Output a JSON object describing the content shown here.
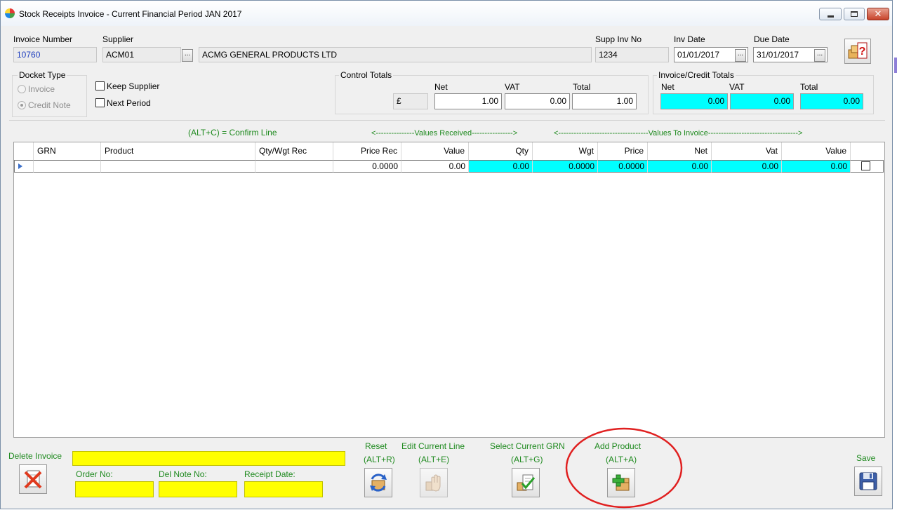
{
  "window": {
    "title": "Stock Receipts Invoice - Current Financial Period JAN 2017",
    "min_glyph": "",
    "close_glyph": "✕"
  },
  "header": {
    "invoice_number_label": "Invoice Number",
    "invoice_number": "10760",
    "supplier_label": "Supplier",
    "supplier_code": "ACM01",
    "supplier_name": "ACMG GENERAL PRODUCTS LTD",
    "supp_inv_no_label": "Supp Inv No",
    "supp_inv_no": "1234",
    "inv_date_label": "Inv Date",
    "inv_date": "01/01/2017",
    "due_date_label": "Due Date",
    "due_date": "31/01/2017",
    "lookup_glyph": "..."
  },
  "docket_type": {
    "title": "Docket Type",
    "options": [
      {
        "label": "Invoice",
        "selected": false
      },
      {
        "label": "Credit Note",
        "selected": true
      }
    ]
  },
  "options": {
    "keep_supplier": "Keep Supplier",
    "next_period": "Next Period"
  },
  "control_totals": {
    "title": "Control Totals",
    "currency": "£",
    "net_label": "Net",
    "vat_label": "VAT",
    "total_label": "Total",
    "net": "1.00",
    "vat": "0.00",
    "total": "1.00"
  },
  "invoice_totals": {
    "title": "Invoice/Credit Totals",
    "net_label": "Net",
    "vat_label": "VAT",
    "total_label": "Total",
    "net": "0.00",
    "vat": "0.00",
    "total": "0.00"
  },
  "grid_captions": {
    "confirm_line": "(ALT+C) = Confirm Line",
    "values_received": "<---------------Values Received---------------->",
    "values_to_invoice": "<-----------------------------------Values To Invoice----------------------------------->"
  },
  "grid": {
    "columns": [
      "GRN",
      "Product",
      "Qty/Wgt Rec",
      "Price Rec",
      "Value",
      "Qty",
      "Wgt",
      "Price",
      "Net",
      "Vat",
      "Value"
    ],
    "row": [
      "",
      "",
      "",
      "0.0000",
      "0.00",
      "0.00",
      "0.0000",
      "0.0000",
      "0.00",
      "0.00",
      "0.00"
    ]
  },
  "footer": {
    "delete_invoice": "Delete Invoice",
    "order_no": "Order No:",
    "del_note_no": "Del Note No:",
    "receipt_date": "Receipt Date:",
    "reset": "Reset",
    "reset_key": "(ALT+R)",
    "edit_line": "Edit Current Line",
    "edit_key": "(ALT+E)",
    "select_grn": "Select Current GRN",
    "select_key": "(ALT+G)",
    "add_product": "Add Product",
    "add_key": "(ALT+A)",
    "save": "Save"
  },
  "colors": {
    "accent_green": "#1f8a1f",
    "cyan": "#00ffff",
    "yellow": "#ffff00",
    "annotation_red": "#e02020"
  }
}
